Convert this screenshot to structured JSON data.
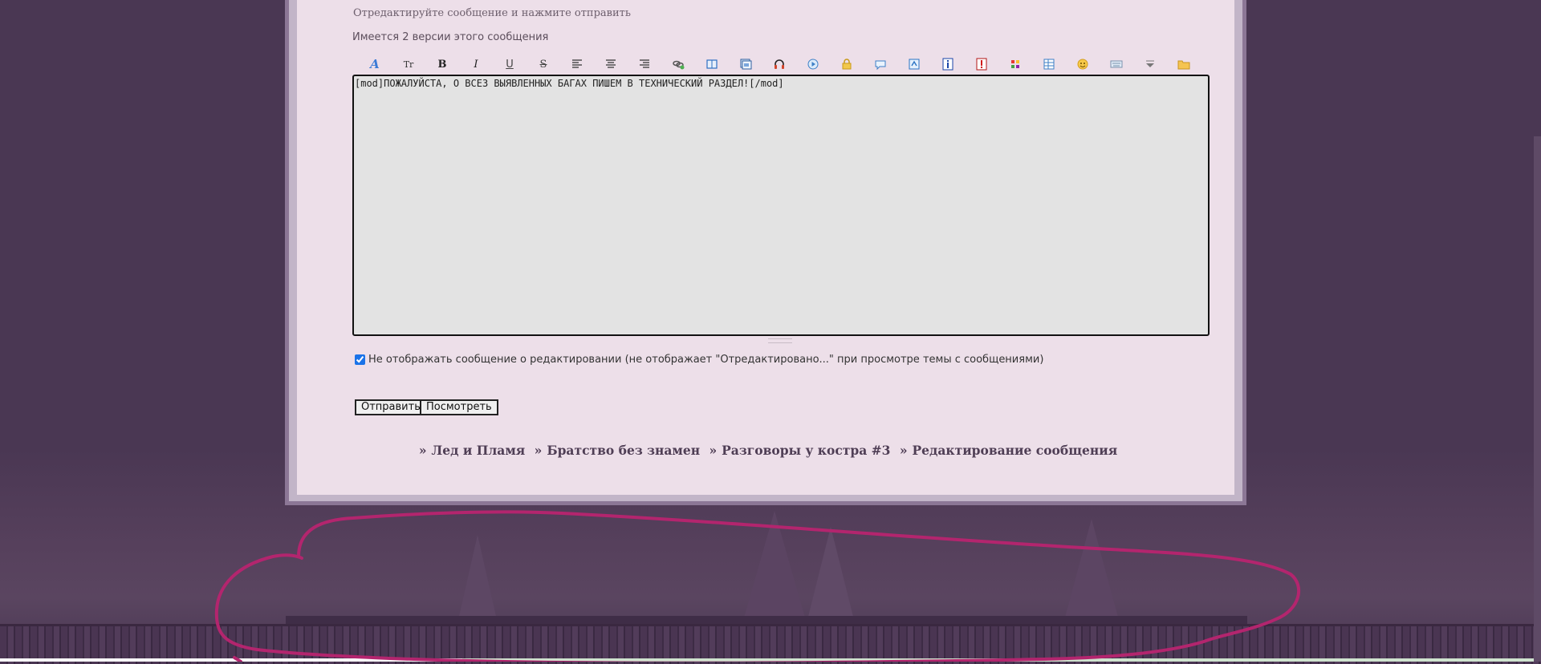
{
  "editor": {
    "hint": "Отредактируйте сообщение и нажмите отправить",
    "versions_note": "Имеется 2 версии этого сообщения",
    "message_text": "[mod]ПОЖАЛУЙСТА, О ВСЕЗ ВЫЯВЛЕННЫХ БАГАХ ПИШЕМ В ТЕХНИЧЕСКИЙ РАЗДЕЛ![/mod]",
    "toolbar": {
      "font_glyph": "A",
      "size_glyph": "Tr",
      "bold_glyph": "B",
      "italic_glyph": "I",
      "underline_glyph": "U",
      "strike_glyph": "S",
      "icons": [
        "font-color-icon",
        "font-size-icon",
        "bold-icon",
        "italic-icon",
        "underline-icon",
        "strikethrough-icon",
        "align-left-icon",
        "align-center-icon",
        "align-right-icon",
        "link-icon",
        "book-icon",
        "image-icon",
        "audio-icon",
        "video-icon",
        "lock-icon",
        "quote-icon",
        "spoiler-icon",
        "info-icon",
        "warning-icon",
        "color-palette-icon",
        "table-icon",
        "smiley-icon",
        "keyboard-icon",
        "dropdown-icon",
        "folder-icon"
      ]
    }
  },
  "options": {
    "hide_edit_notice_label": "Не отображать сообщение о редактировании (не отображает \"Отредактировано...\" при просмотре темы с сообщениями)",
    "hide_edit_notice_checked": true
  },
  "actions": {
    "submit_label": "Отправить",
    "preview_label": "Посмотреть"
  },
  "breadcrumb": {
    "separator": "»",
    "items": [
      "Лед и Пламя",
      "Братство без знамен",
      "Разговоры у костра #3",
      "Редактирование сообщения"
    ]
  },
  "colors": {
    "page_bg": "#4a3753",
    "panel_bg": "#eddfe9",
    "editor_bg": "#e3e3e3",
    "annotation": "#b3256e"
  }
}
